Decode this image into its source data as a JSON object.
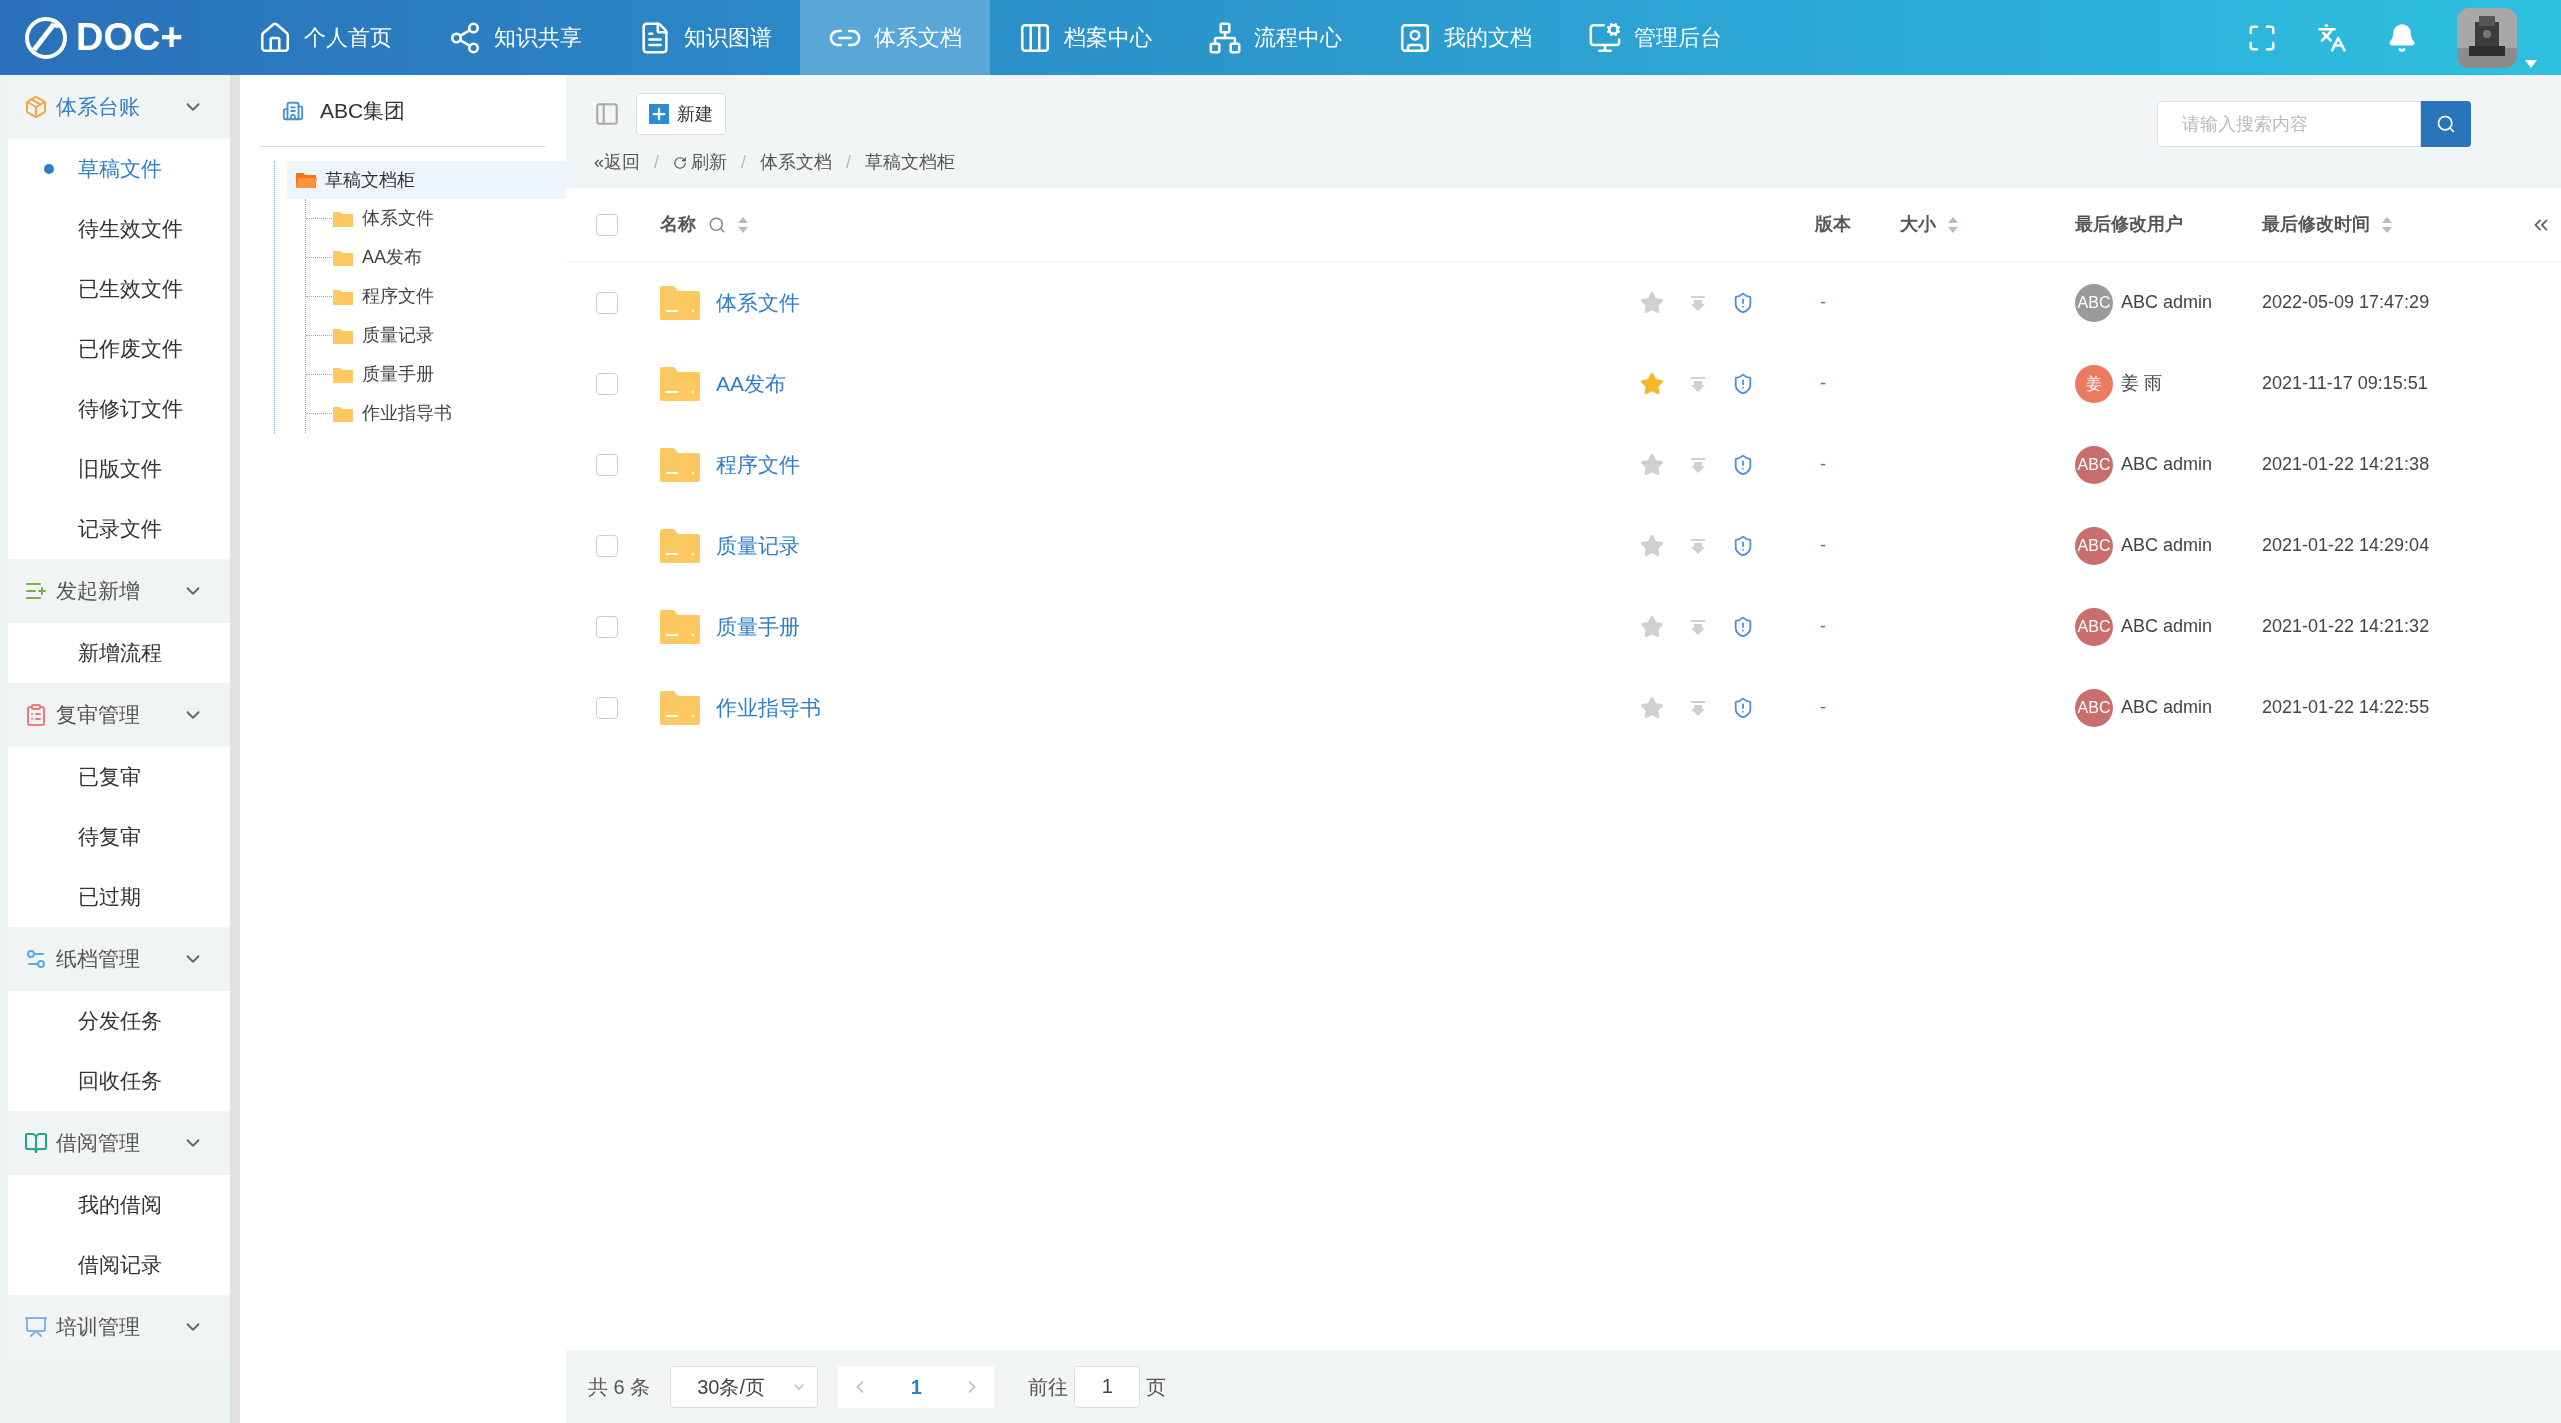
{
  "logo": {
    "text": "DOC+"
  },
  "nav": [
    {
      "label": "个人首页",
      "selected": false
    },
    {
      "label": "知识共享",
      "selected": false
    },
    {
      "label": "知识图谱",
      "selected": false
    },
    {
      "label": "体系文档",
      "selected": true
    },
    {
      "label": "档案中心",
      "selected": false
    },
    {
      "label": "流程中心",
      "selected": false
    },
    {
      "label": "我的文档",
      "selected": false
    },
    {
      "label": "管理后台",
      "selected": false
    }
  ],
  "sidebar": {
    "groups": [
      {
        "label": "体系台账",
        "color": "#f0a848",
        "selected": true,
        "items": [
          {
            "label": "草稿文件",
            "selected": true
          },
          {
            "label": "待生效文件",
            "selected": false
          },
          {
            "label": "已生效文件",
            "selected": false
          },
          {
            "label": "已作废文件",
            "selected": false
          },
          {
            "label": "待修订文件",
            "selected": false
          },
          {
            "label": "旧版文件",
            "selected": false
          },
          {
            "label": "记录文件",
            "selected": false
          }
        ]
      },
      {
        "label": "发起新增",
        "color": "#7cae4a",
        "selected": false,
        "items": [
          {
            "label": "新增流程",
            "selected": false
          }
        ]
      },
      {
        "label": "复审管理",
        "color": "#ec7a7a",
        "selected": false,
        "items": [
          {
            "label": "已复审",
            "selected": false
          },
          {
            "label": "待复审",
            "selected": false
          },
          {
            "label": "已过期",
            "selected": false
          }
        ]
      },
      {
        "label": "纸档管理",
        "color": "#5da8e0",
        "selected": false,
        "items": [
          {
            "label": "分发任务",
            "selected": false
          },
          {
            "label": "回收任务",
            "selected": false
          }
        ]
      },
      {
        "label": "借阅管理",
        "color": "#23a77f",
        "selected": false,
        "items": [
          {
            "label": "我的借阅",
            "selected": false
          },
          {
            "label": "借阅记录",
            "selected": false
          }
        ]
      },
      {
        "label": "培训管理",
        "color": "#7fb5e4",
        "selected": false
      }
    ]
  },
  "tree": {
    "title": "ABC集团",
    "root": {
      "label": "草稿文档柜",
      "selected": true,
      "children": [
        {
          "label": "体系文件"
        },
        {
          "label": "AA发布"
        },
        {
          "label": "程序文件"
        },
        {
          "label": "质量记录"
        },
        {
          "label": "质量手册"
        },
        {
          "label": "作业指导书"
        }
      ]
    }
  },
  "toolbar": {
    "new_button": "新建"
  },
  "search": {
    "placeholder": "请输入搜索内容"
  },
  "breadcrumb": [
    {
      "label": "«返回",
      "kind": "back"
    },
    {
      "label": "/",
      "kind": "separator"
    },
    {
      "label": "刷新",
      "kind": "refresh"
    },
    {
      "label": "/",
      "kind": "separator"
    },
    {
      "label": "体系文档",
      "kind": "link"
    },
    {
      "label": "/",
      "kind": "separator"
    },
    {
      "label": "草稿文档柜",
      "kind": "link"
    }
  ],
  "table": {
    "select_all_checked": false,
    "columns": [
      "名称",
      "版本",
      "大小",
      "最后修改用户",
      "最后修改时间"
    ],
    "rows": [
      {
        "checked": false,
        "name": "体系文件",
        "starred": false,
        "version": "-",
        "avatar": "ABC",
        "color": "#9a9a9a",
        "user": "ABC admin",
        "modified": "2022-05-09 17:47:29"
      },
      {
        "checked": false,
        "name": "AA发布",
        "starred": true,
        "version": "-",
        "avatar": "姜",
        "color": "#ec7a5e",
        "user": "姜 雨",
        "modified": "2021-11-17 09:15:51"
      },
      {
        "checked": false,
        "name": "程序文件",
        "starred": false,
        "version": "-",
        "avatar": "ABC",
        "color": "#c86e6e",
        "user": "ABC admin",
        "modified": "2021-01-22 14:21:38"
      },
      {
        "checked": false,
        "name": "质量记录",
        "starred": false,
        "version": "-",
        "avatar": "ABC",
        "color": "#c86e6e",
        "user": "ABC admin",
        "modified": "2021-01-22 14:29:04"
      },
      {
        "checked": false,
        "name": "质量手册",
        "starred": false,
        "version": "-",
        "avatar": "ABC",
        "color": "#c86e6e",
        "user": "ABC admin",
        "modified": "2021-01-22 14:21:32"
      },
      {
        "checked": false,
        "name": "作业指导书",
        "starred": false,
        "version": "-",
        "avatar": "ABC",
        "color": "#c86e6e",
        "user": "ABC admin",
        "modified": "2021-01-22 14:22:55"
      }
    ]
  },
  "pagination": {
    "total": "共 6 条",
    "page_size": "30条/页",
    "current_page": "1",
    "goto_label": "前往",
    "goto_value": "1",
    "page_suffix": "页"
  }
}
